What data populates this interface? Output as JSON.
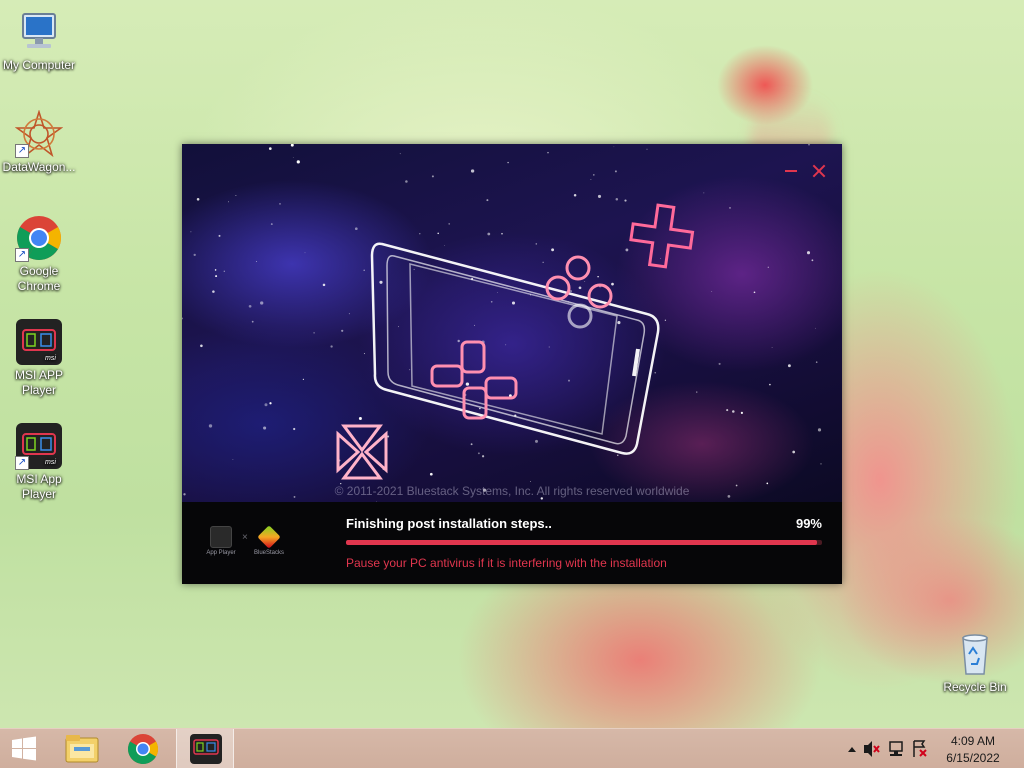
{
  "desktop": {
    "icons": [
      {
        "label": "My Computer",
        "icon": "computer-icon"
      },
      {
        "label": "DataWagon...",
        "icon": "datawagon-icon"
      },
      {
        "label": "Google Chrome",
        "icon": "chrome-icon"
      },
      {
        "label": "MSI APP Player",
        "icon": "msi-app-player-icon"
      },
      {
        "label": "MSI App Player",
        "icon": "msi-app-player-icon"
      },
      {
        "label": "Recycle Bin",
        "icon": "recycle-bin-icon"
      }
    ]
  },
  "installer": {
    "copyright": "© 2011-2021 Bluestack Systems, Inc. All rights reserved worldwide",
    "status": "Finishing post installation steps..",
    "percent_label": "99%",
    "progress": 0.99,
    "hint": "Pause your PC antivirus if it is interfering with the installation",
    "logos": {
      "left_caption": "App Player",
      "separator": "×",
      "right_caption": "BlueStacks"
    },
    "accent_color": "#e0364e"
  },
  "taskbar": {
    "buttons": [
      {
        "icon": "windows-start-icon"
      },
      {
        "icon": "file-explorer-icon"
      },
      {
        "icon": "chrome-icon"
      },
      {
        "icon": "msi-app-player-icon",
        "active": true
      }
    ],
    "tray_icons": [
      "show-hidden-icons-chevron",
      "volume-muted-icon",
      "network-icon",
      "action-center-icon"
    ],
    "clock": {
      "time": "4:09 AM",
      "date": "6/15/2022"
    }
  }
}
